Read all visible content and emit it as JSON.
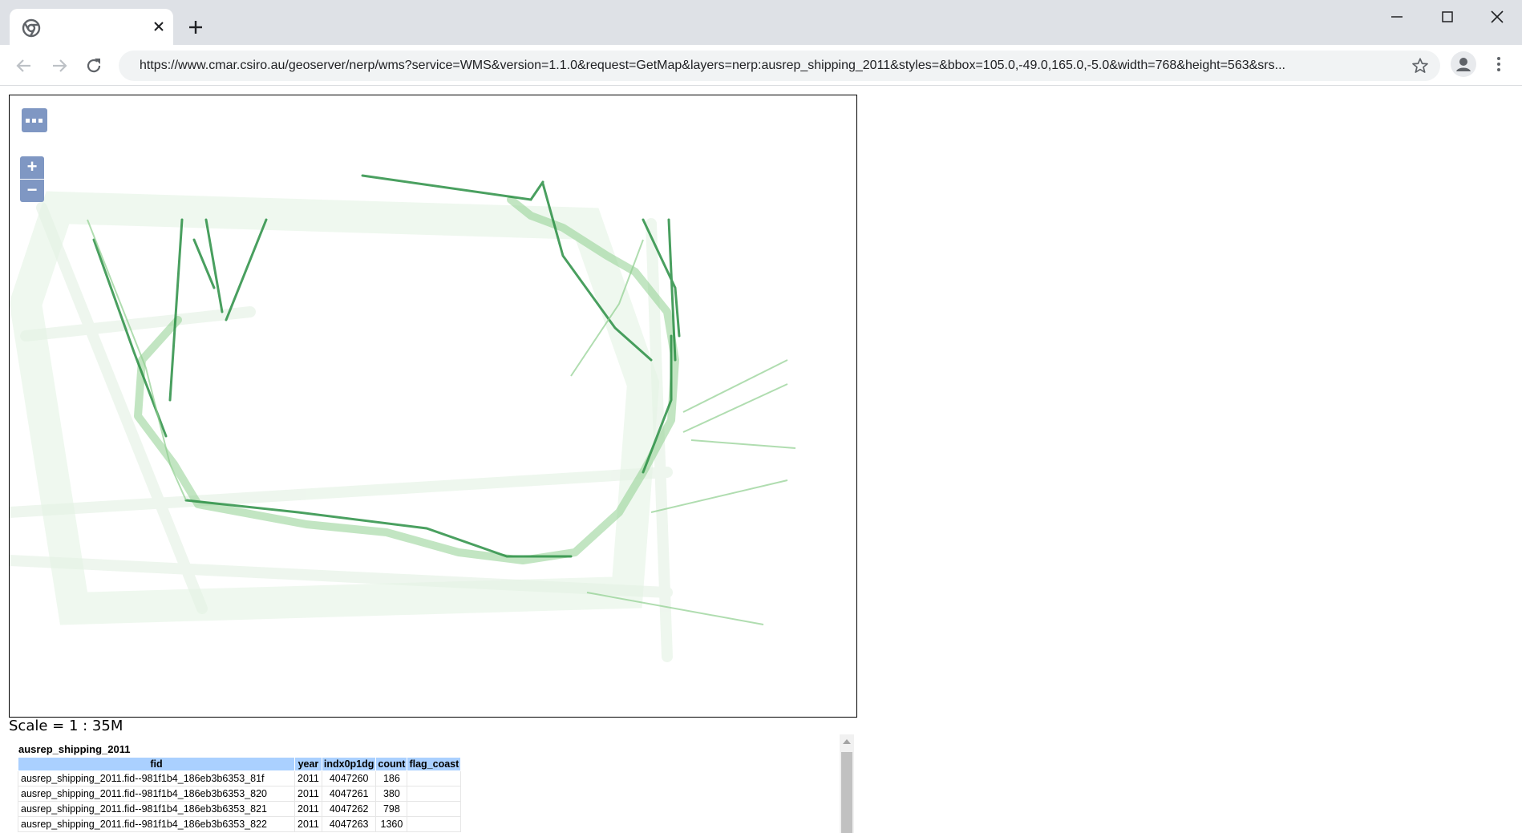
{
  "browser": {
    "tab_close_icon": "close-icon",
    "new_tab_icon": "plus-icon",
    "url": "https://www.cmar.csiro.au/geoserver/nerp/wms?service=WMS&version=1.1.0&request=GetMap&layers=nerp:ausrep_shipping_2011&styles=&bbox=105.0,-49.0,165.0,-5.0&width=768&height=563&srs...",
    "icons": [
      "back-arrow-icon",
      "forward-arrow-icon",
      "reload-icon",
      "star-icon",
      "profile-icon",
      "kebab-menu-icon",
      "minimize-icon",
      "maximize-icon",
      "close-window-icon"
    ]
  },
  "map": {
    "layer_switcher_label": "...",
    "zoom_in_label": "+",
    "zoom_out_label": "−",
    "route_color": "#1f8a3a",
    "scale_text": "Scale = 1 : 35M"
  },
  "feature_info": {
    "layer_title": "ausrep_shipping_2011",
    "columns": [
      "fid",
      "year",
      "indx0p1dg",
      "count",
      "flag_coast"
    ],
    "rows": [
      {
        "fid": "ausrep_shipping_2011.fid--981f1b4_186eb3b6353_81f",
        "year": "2011",
        "indx0p1dg": "4047260",
        "count": "186",
        "flag_coast": ""
      },
      {
        "fid": "ausrep_shipping_2011.fid--981f1b4_186eb3b6353_820",
        "year": "2011",
        "indx0p1dg": "4047261",
        "count": "380",
        "flag_coast": ""
      },
      {
        "fid": "ausrep_shipping_2011.fid--981f1b4_186eb3b6353_821",
        "year": "2011",
        "indx0p1dg": "4047262",
        "count": "798",
        "flag_coast": ""
      },
      {
        "fid": "ausrep_shipping_2011.fid--981f1b4_186eb3b6353_822",
        "year": "2011",
        "indx0p1dg": "4047263",
        "count": "1360",
        "flag_coast": ""
      }
    ]
  }
}
